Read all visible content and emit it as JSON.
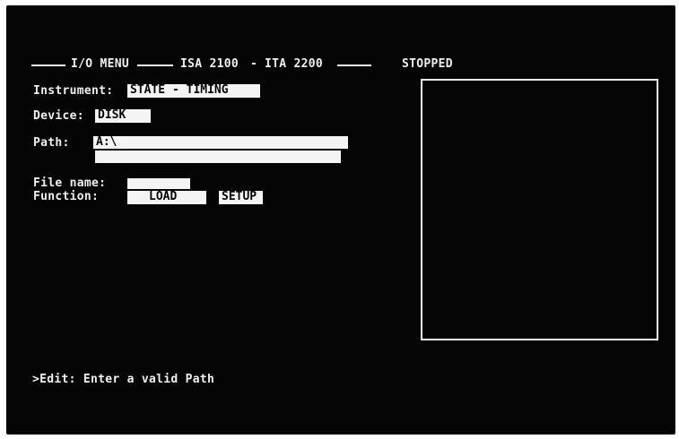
{
  "header": {
    "menu_title": "I/O MENU",
    "isa_model": "ISA 2100",
    "separator": "-",
    "ita_model": "ITA 2200",
    "status": "STOPPED"
  },
  "form": {
    "instrument_label": "Instrument:",
    "instrument_value": "STATE - TIMING",
    "device_label": "Device:",
    "device_value": "DISK",
    "path_label": "Path:",
    "path_value": "A:\\",
    "file_name_label": "File name:",
    "file_name_value": "",
    "function_label": "Function:",
    "function_load": "LOAD",
    "function_setup": "SETUP"
  },
  "prompt": {
    "message": ">Edit: Enter a valid Path"
  },
  "colors": {
    "background": "#050505",
    "foreground": "#f0f0f0"
  }
}
